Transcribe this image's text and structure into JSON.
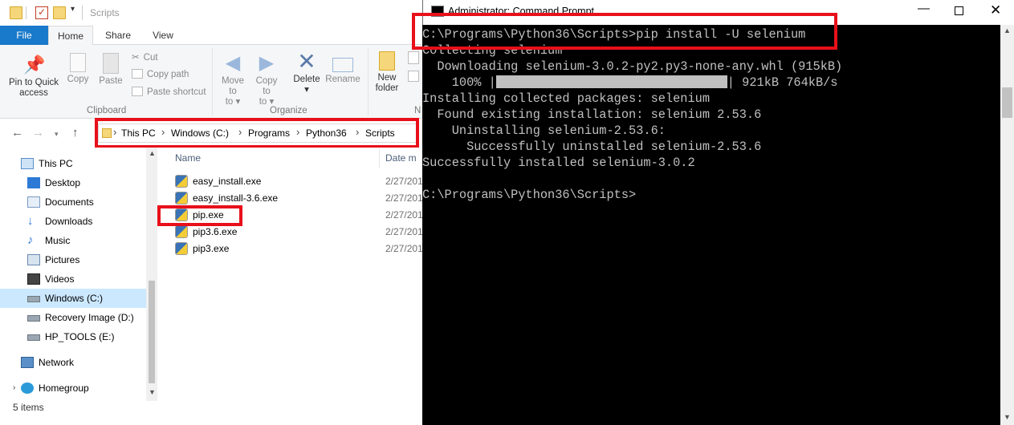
{
  "explorer": {
    "title": "Scripts",
    "tabs": [
      "File",
      "Home",
      "Share",
      "View"
    ],
    "ribbon": {
      "clipboard": {
        "label": "Clipboard",
        "pin": "Pin to Quick access",
        "copy": "Copy",
        "paste": "Paste",
        "cut": "Cut",
        "copy_path": "Copy path",
        "paste_shortcut": "Paste shortcut"
      },
      "organize": {
        "label": "Organize",
        "move_to": "Move to",
        "copy_to": "Copy to",
        "delete": "Delete",
        "rename": "Rename"
      },
      "new": {
        "label": "N",
        "new_folder": "New folder"
      }
    },
    "breadcrumb": [
      "This PC",
      "Windows (C:)",
      "Programs",
      "Python36",
      "Scripts"
    ],
    "nav": [
      {
        "label": "This PC",
        "icon": "computer-icon"
      },
      {
        "label": "Desktop",
        "icon": "desktop-icon"
      },
      {
        "label": "Documents",
        "icon": "documents-icon"
      },
      {
        "label": "Downloads",
        "icon": "downloads-icon"
      },
      {
        "label": "Music",
        "icon": "music-icon"
      },
      {
        "label": "Pictures",
        "icon": "pictures-icon"
      },
      {
        "label": "Videos",
        "icon": "videos-icon"
      },
      {
        "label": "Windows (C:)",
        "icon": "drive-icon",
        "selected": true
      },
      {
        "label": "Recovery Image (D:)",
        "icon": "drive-icon"
      },
      {
        "label": "HP_TOOLS (E:)",
        "icon": "drive-icon"
      },
      {
        "label": "Network",
        "icon": "network-icon"
      },
      {
        "label": "Homegroup",
        "icon": "homegroup-icon"
      }
    ],
    "columns": {
      "name": "Name",
      "date": "Date m"
    },
    "files": [
      {
        "name": "easy_install.exe",
        "date": "2/27/201"
      },
      {
        "name": "easy_install-3.6.exe",
        "date": "2/27/201"
      },
      {
        "name": "pip.exe",
        "date": "2/27/201"
      },
      {
        "name": "pip3.6.exe",
        "date": "2/27/201"
      },
      {
        "name": "pip3.exe",
        "date": "2/27/201"
      }
    ],
    "status": "5 items"
  },
  "cmd": {
    "title": "Administrator: Command Prompt",
    "lines": {
      "l1": "C:\\Programs\\Python36\\Scripts>pip install -U selenium",
      "l2": "Collecting selenium",
      "l3": "  Downloading selenium-3.0.2-py2.py3-none-any.whl (915kB)",
      "l4a": "    100% |",
      "l4b": "| 921kB 764kB/s",
      "l5": "Installing collected packages: selenium",
      "l6": "  Found existing installation: selenium 2.53.6",
      "l7": "    Uninstalling selenium-2.53.6:",
      "l8": "      Successfully uninstalled selenium-2.53.6",
      "l9": "Successfully installed selenium-3.0.2",
      "l10": "",
      "l11": "C:\\Programs\\Python36\\Scripts>"
    },
    "progress": 1.0
  },
  "colors": {
    "highlight": "#e8101a",
    "file_tab": "#1979ca",
    "selection": "#cce8ff"
  }
}
